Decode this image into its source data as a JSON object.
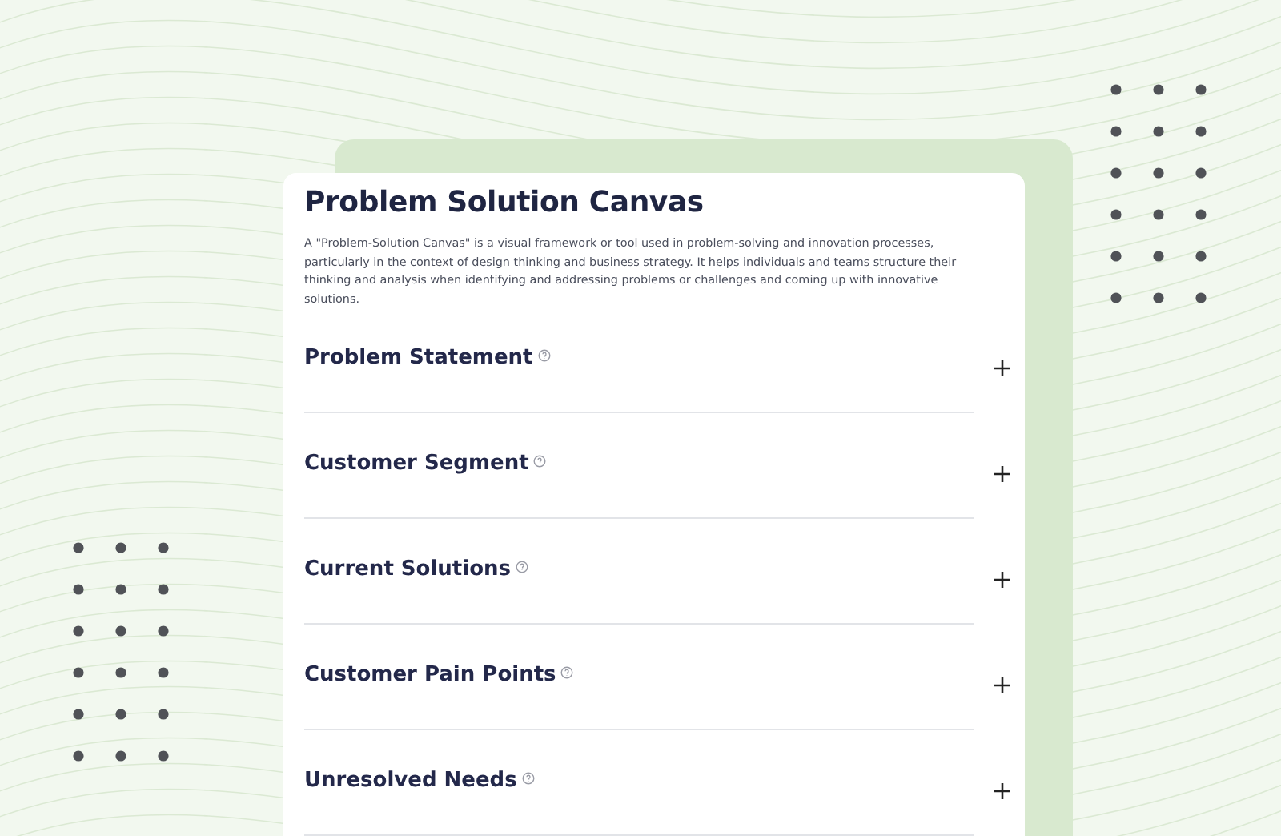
{
  "title": "Problem Solution Canvas",
  "description": "A \"Problem-Solution Canvas\" is a visual framework or tool used in problem-solving and innovation processes, particularly in the context of design thinking and business strategy. It helps individuals and teams structure their thinking and analysis when identifying and addressing problems or challenges and coming up with innovative solutions.",
  "sections": [
    {
      "title": "Problem Statement",
      "expanded": false
    },
    {
      "title": "Customer Segment",
      "expanded": false
    },
    {
      "title": "Current Solutions",
      "expanded": false
    },
    {
      "title": "Customer Pain Points",
      "expanded": false
    },
    {
      "title": "Unresolved Needs",
      "expanded": false
    }
  ]
}
